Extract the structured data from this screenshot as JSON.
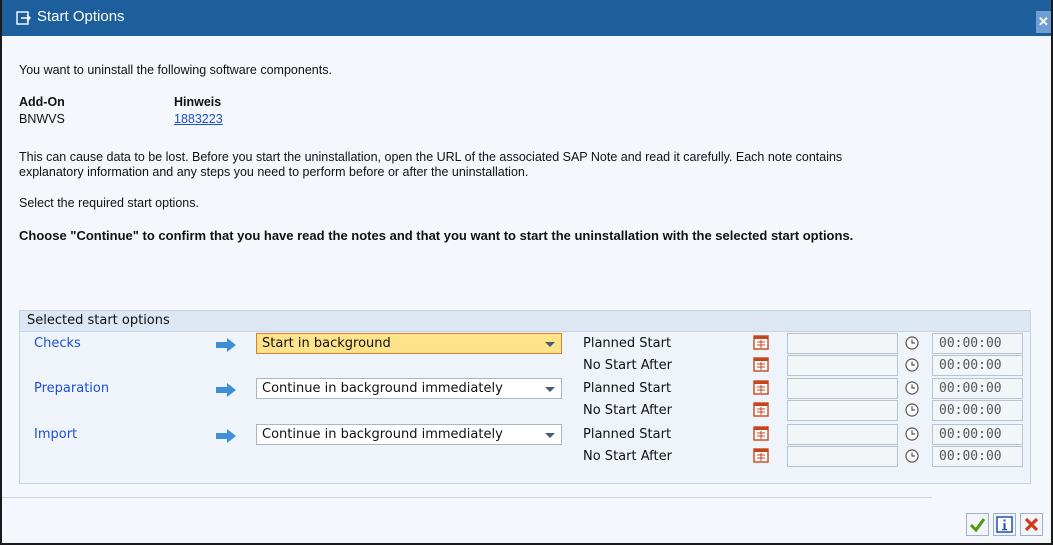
{
  "window": {
    "title": "Start Options",
    "close_icon": "close-icon"
  },
  "intro": "You want to uninstall the following software components.",
  "components_table": {
    "headers": [
      "Add-On",
      "Hinweis"
    ],
    "rows": [
      {
        "addon": "BNWVS",
        "note": "1883223"
      }
    ]
  },
  "warning": {
    "line1": "This can cause data to be lost. Before you start the uninstallation, open the URL of the associated SAP Note and read it carefully. Each note contains",
    "line2": "explanatory information and any steps you need to perform before or after the uninstallation."
  },
  "select_text": "Select the required start options.",
  "continue_text": "Choose \"Continue\" to confirm that you have read the notes and that you want to start the uninstallation with the selected start options.",
  "group": {
    "title": "Selected start options",
    "phases": [
      {
        "name": "Checks",
        "option": "Start in background",
        "highlighted": true,
        "rows": [
          {
            "label": "Planned Start",
            "time": "00:00:00"
          },
          {
            "label": "No Start After",
            "time": "00:00:00"
          }
        ]
      },
      {
        "name": "Preparation",
        "option": "Continue in background immediately",
        "highlighted": false,
        "rows": [
          {
            "label": "Planned Start",
            "time": "00:00:00"
          },
          {
            "label": "No Start After",
            "time": "00:00:00"
          }
        ]
      },
      {
        "name": "Import",
        "option": "Continue in background immediately",
        "highlighted": false,
        "rows": [
          {
            "label": "Planned Start",
            "time": "00:00:00"
          },
          {
            "label": "No Start After",
            "time": "00:00:00"
          }
        ]
      }
    ]
  },
  "buttons": [
    {
      "name": "continue",
      "icon": "checkmark-icon",
      "color": "#4a9a12"
    },
    {
      "name": "info",
      "icon": "info-icon",
      "color": "#1f4fb0"
    },
    {
      "name": "cancel",
      "icon": "cancel-icon",
      "color": "#d23a1a"
    }
  ],
  "colors": {
    "titlebar": "#1c5f9c",
    "link": "#1d4fcf",
    "highlight": "#ffe38a",
    "arrow": "#3f8fd8"
  }
}
